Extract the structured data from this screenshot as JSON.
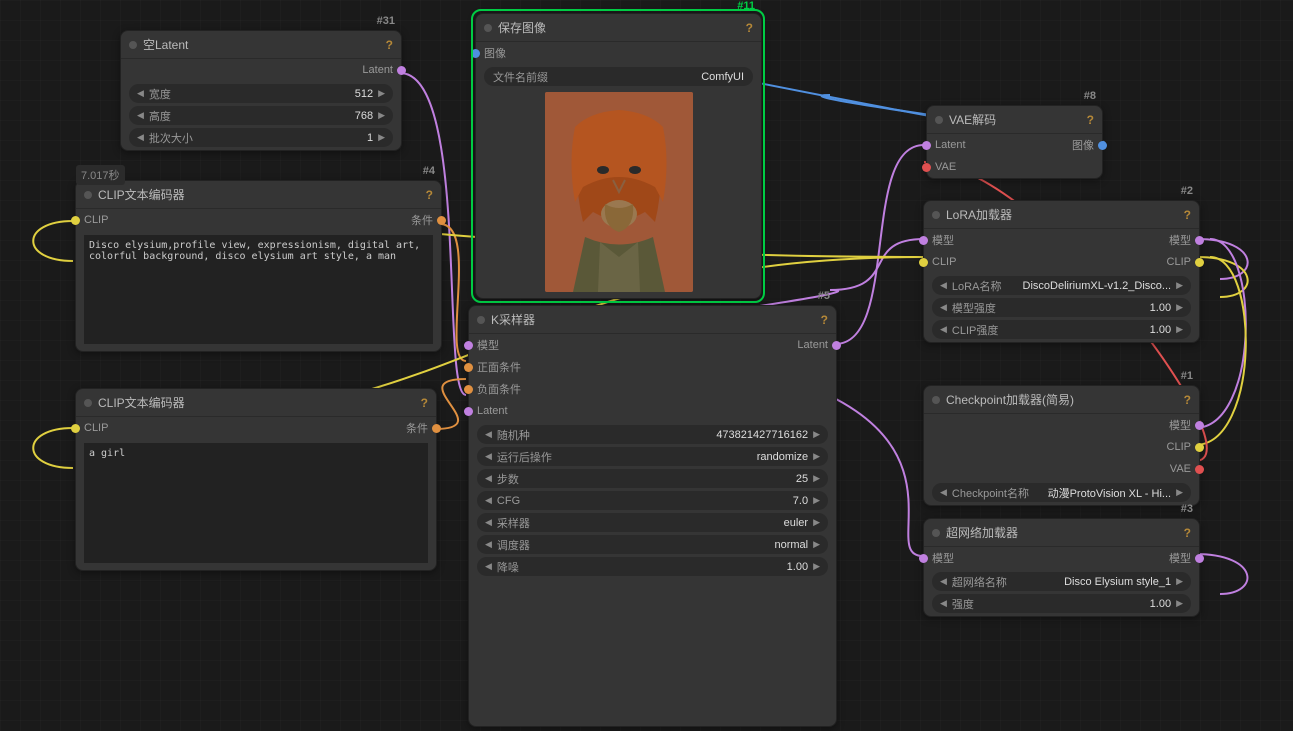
{
  "nodes": {
    "emptyLatent": {
      "id": "#31",
      "title": "空Latent",
      "output": "Latent",
      "w": [
        {
          "l": "宽度",
          "v": "512"
        },
        {
          "l": "高度",
          "v": "768"
        },
        {
          "l": "批次大小",
          "v": "1"
        }
      ]
    },
    "clipPos": {
      "id": "#4",
      "title": "CLIP文本编码器",
      "tag": "7.017秒",
      "in": "CLIP",
      "out": "条件",
      "text": "Disco elysium,profile view, expressionism, digital art, colorful background, disco elysium art style, a man"
    },
    "clipNeg": {
      "title": "CLIP文本编码器",
      "in": "CLIP",
      "out": "条件",
      "text": "a girl"
    },
    "save": {
      "id": "#11",
      "title": "保存图像",
      "in": "图像",
      "w": [
        {
          "l": "文件名前缀",
          "v": "ComfyUI"
        }
      ]
    },
    "ksampler": {
      "id": "#5",
      "title": "K采样器",
      "out": "Latent",
      "ins": [
        "模型",
        "正面条件",
        "负面条件",
        "Latent"
      ],
      "w": [
        {
          "l": "随机种",
          "v": "473821427716162"
        },
        {
          "l": "运行后操作",
          "v": "randomize"
        },
        {
          "l": "步数",
          "v": "25"
        },
        {
          "l": "CFG",
          "v": "7.0"
        },
        {
          "l": "采样器",
          "v": "euler"
        },
        {
          "l": "调度器",
          "v": "normal"
        },
        {
          "l": "降噪",
          "v": "1.00"
        }
      ]
    },
    "vae": {
      "id": "#8",
      "title": "VAE解码",
      "ins": [
        "Latent",
        "VAE"
      ],
      "out": "图像"
    },
    "lora": {
      "id": "#2",
      "title": "LoRA加载器",
      "ins": [
        "模型",
        "CLIP"
      ],
      "outs": [
        "模型",
        "CLIP"
      ],
      "w": [
        {
          "l": "LoRA名称",
          "v": "DiscoDeliriumXL-v1.2_Disco..."
        },
        {
          "l": "模型强度",
          "v": "1.00"
        },
        {
          "l": "CLIP强度",
          "v": "1.00"
        }
      ]
    },
    "ckpt": {
      "id": "#1",
      "title": "Checkpoint加载器(简易)",
      "outs": [
        "模型",
        "CLIP",
        "VAE"
      ],
      "w": [
        {
          "l": "Checkpoint名称",
          "v": "动漫ProtoVision XL - Hi..."
        }
      ]
    },
    "hyper": {
      "id": "#3",
      "title": "超网络加载器",
      "in": "模型",
      "out": "模型",
      "w": [
        {
          "l": "超网络名称",
          "v": "Disco Elysium style_1"
        },
        {
          "l": "强度",
          "v": "1.00"
        }
      ]
    }
  }
}
